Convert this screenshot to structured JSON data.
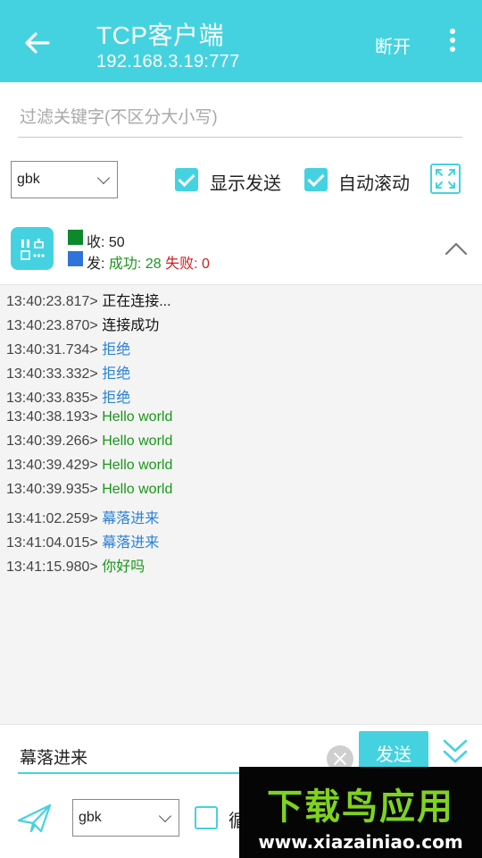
{
  "header": {
    "title": "TCP客户端",
    "address": "192.168.3.19:777",
    "disconnect_label": "断开"
  },
  "filter": {
    "placeholder": "过滤关键字(不区分大小写)"
  },
  "options": {
    "encoding": "gbk",
    "show_send_label": "显示发送",
    "show_send_checked": true,
    "auto_scroll_label": "自动滚动",
    "auto_scroll_checked": true
  },
  "stats": {
    "recv_label": "收:",
    "recv_count": "50",
    "send_label": "发:",
    "success_label": "成功:",
    "success_count": "28",
    "fail_label": "失败:",
    "fail_count": "0",
    "recv_color": "#0a8a2a",
    "send_color": "#2f74d8"
  },
  "log": [
    {
      "time": "13:40:23.817>",
      "text": "正在连接...",
      "color": "black"
    },
    {
      "time": "13:40:23.870>",
      "text": "连接成功",
      "color": "black"
    },
    {
      "time": "13:40:31.734>",
      "text": "拒绝",
      "color": "blue"
    },
    {
      "time": "13:40:33.332>",
      "text": "拒绝",
      "color": "blue"
    },
    {
      "time": "13:40:33.835>",
      "text": "拒绝",
      "color": "blue"
    },
    {
      "time": "13:40:38.193>",
      "text": "Hello world",
      "color": "green"
    },
    {
      "time": "13:40:39.266>",
      "text": "Hello world",
      "color": "green"
    },
    {
      "time": "13:40:39.429>",
      "text": "Hello world",
      "color": "green"
    },
    {
      "time": "13:40:39.935>",
      "text": "Hello world",
      "color": "green"
    },
    {
      "time": "13:41:02.259>",
      "text": "幕落进来",
      "color": "blue"
    },
    {
      "time": "13:41:04.015>",
      "text": "幕落进来",
      "color": "blue"
    },
    {
      "time": "13:41:15.980>",
      "text": "你好吗",
      "color": "green"
    }
  ],
  "composer": {
    "message_value": "幕落进来",
    "send_label": "发送",
    "encoding": "gbk",
    "loop_label": "循",
    "loop_checked": false
  },
  "watermark": {
    "brand": "下载鸟应用",
    "url": "www.xiazainiao.com"
  },
  "colors": {
    "accent": "#45d2e0"
  }
}
